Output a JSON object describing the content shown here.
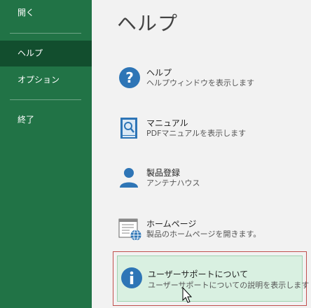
{
  "sidebar": {
    "items": [
      {
        "label": "開く"
      },
      {
        "label": "ヘルプ"
      },
      {
        "label": "オプション"
      },
      {
        "label": "終了"
      }
    ]
  },
  "main": {
    "title": "ヘルプ",
    "entries": [
      {
        "title": "ヘルプ",
        "subtitle": "ヘルプウィンドウを表示します",
        "icon": "question-icon"
      },
      {
        "title": "マニュアル",
        "subtitle": "PDFマニュアルを表示します",
        "icon": "manual-book-icon"
      },
      {
        "title": "製品登録",
        "subtitle": "アンテナハウス",
        "icon": "user-icon"
      },
      {
        "title": "ホームページ",
        "subtitle": "製品のホームページを開きます。",
        "icon": "webpage-globe-icon"
      },
      {
        "title": "ユーザーサポートについて",
        "subtitle": "ユーザーサポートについての説明を表示します",
        "icon": "info-icon"
      }
    ]
  },
  "colors": {
    "sidebar_bg": "#217346",
    "sidebar_active": "#124e2e",
    "icon_blue": "#2e75b6",
    "hover_bg": "#d9f0e1",
    "highlight_border": "#c0504d"
  }
}
